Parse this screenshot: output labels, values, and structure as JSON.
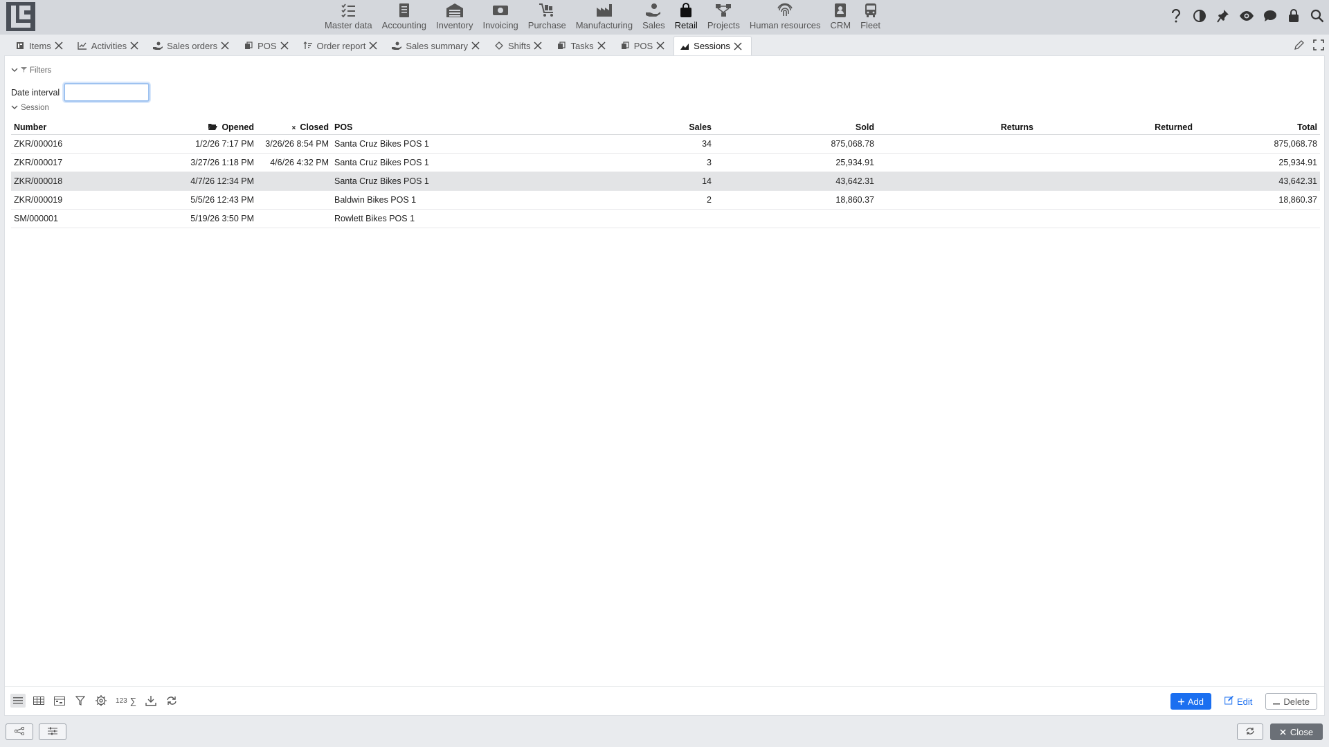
{
  "colors": {
    "accent": "#1b6ff0",
    "topbar": "#d4d7dc",
    "selected_row": "#e3e4e6"
  },
  "modules": [
    {
      "label": "Master data",
      "icon": "checklist-icon"
    },
    {
      "label": "Accounting",
      "icon": "ledger-icon"
    },
    {
      "label": "Inventory",
      "icon": "warehouse-icon"
    },
    {
      "label": "Invoicing",
      "icon": "banknote-icon"
    },
    {
      "label": "Purchase",
      "icon": "cart-icon"
    },
    {
      "label": "Manufacturing",
      "icon": "factory-icon"
    },
    {
      "label": "Sales",
      "icon": "hand-coin-icon"
    },
    {
      "label": "Retail",
      "icon": "shopping-bag-icon",
      "active": true
    },
    {
      "label": "Projects",
      "icon": "hierarchy-icon"
    },
    {
      "label": "Human resources",
      "icon": "fingerprint-icon"
    },
    {
      "label": "CRM",
      "icon": "contact-card-icon"
    },
    {
      "label": "Fleet",
      "icon": "bus-icon"
    }
  ],
  "tabs": [
    {
      "label": "Items",
      "icon": "items-icon"
    },
    {
      "label": "Activities",
      "icon": "line-chart-icon"
    },
    {
      "label": "Sales orders",
      "icon": "hand-coin-icon"
    },
    {
      "label": "POS",
      "icon": "copy-icon"
    },
    {
      "label": "Order report",
      "icon": "sort-icon"
    },
    {
      "label": "Sales summary",
      "icon": "hand-coin-icon"
    },
    {
      "label": "Shifts",
      "icon": "diamond-icon"
    },
    {
      "label": "Tasks",
      "icon": "copy-icon"
    },
    {
      "label": "POS",
      "icon": "copy-icon"
    },
    {
      "label": "Sessions",
      "icon": "area-chart-icon",
      "active": true
    }
  ],
  "filters": {
    "toggle_label": "Filters",
    "date_interval_label": "Date interval",
    "date_interval_value": ""
  },
  "session_toggle_label": "Session",
  "table": {
    "columns": {
      "number": "Number",
      "opened": "Opened",
      "closed": "Closed",
      "pos": "POS",
      "sales": "Sales",
      "sold": "Sold",
      "returns": "Returns",
      "returned": "Returned",
      "total": "Total"
    },
    "rows": [
      {
        "number": "ZKR/000016",
        "opened": "1/2/26 7:17 PM",
        "closed": "3/26/26 8:54 PM",
        "pos": "Santa Cruz Bikes POS 1",
        "sales": "34",
        "sold": "875,068.78",
        "returns": "",
        "returned": "",
        "total": "875,068.78"
      },
      {
        "number": "ZKR/000017",
        "opened": "3/27/26 1:18 PM",
        "closed": "4/6/26 4:32 PM",
        "pos": "Santa Cruz Bikes POS 1",
        "sales": "3",
        "sold": "25,934.91",
        "returns": "",
        "returned": "",
        "total": "25,934.91"
      },
      {
        "number": "ZKR/000018",
        "opened": "4/7/26 12:34 PM",
        "closed": "",
        "pos": "Santa Cruz Bikes POS 1",
        "sales": "14",
        "sold": "43,642.31",
        "returns": "",
        "returned": "",
        "total": "43,642.31",
        "selected": true
      },
      {
        "number": "ZKR/000019",
        "opened": "5/5/26 12:43 PM",
        "closed": "",
        "pos": "Baldwin Bikes POS 1",
        "sales": "2",
        "sold": "18,860.37",
        "returns": "",
        "returned": "",
        "total": "18,860.37"
      },
      {
        "number": "SM/000001",
        "opened": "5/19/26 3:50 PM",
        "closed": "",
        "pos": "Rowlett Bikes POS 1",
        "sales": "",
        "sold": "",
        "returns": "",
        "returned": "",
        "total": ""
      }
    ]
  },
  "bottombar": {
    "sum_label": "123",
    "add_label": "Add",
    "edit_label": "Edit",
    "delete_label": "Delete"
  },
  "footer": {
    "close_label": "Close"
  }
}
